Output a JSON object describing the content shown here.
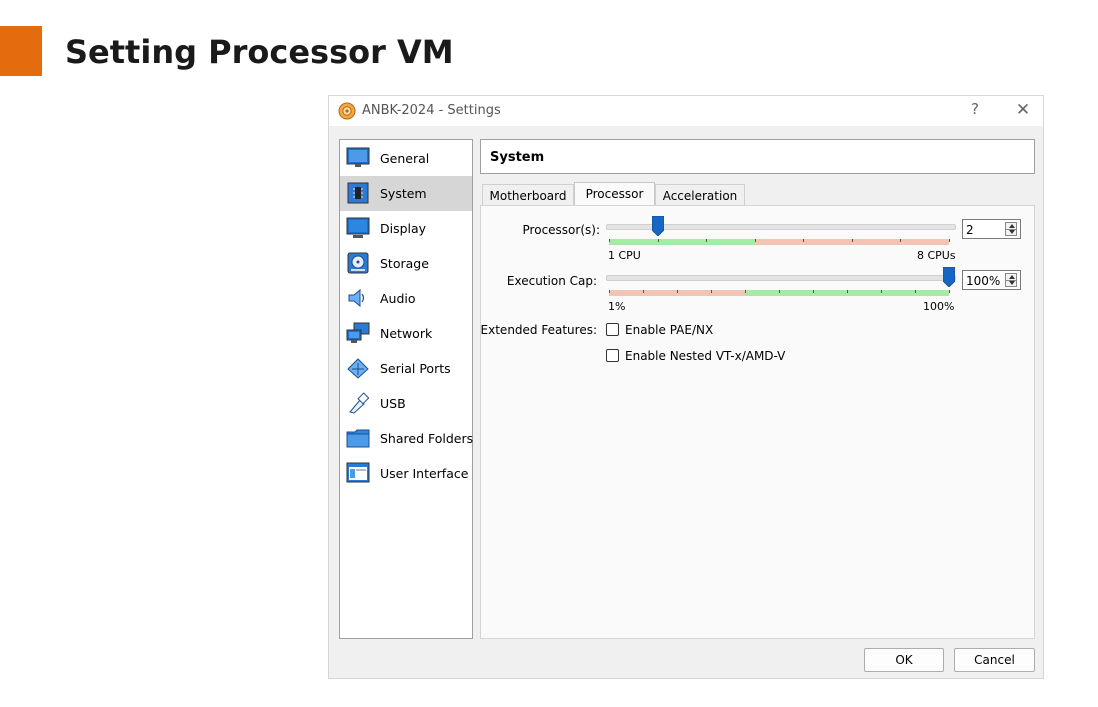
{
  "slide": {
    "title": "Setting Processor VM",
    "accent_color": "#e26c0e"
  },
  "window": {
    "title": "ANBK-2024 - Settings",
    "help_glyph": "?",
    "close_glyph": "✕",
    "app_icon": "virtualbox-gear-icon"
  },
  "sidebar": {
    "items": [
      {
        "label": "General",
        "icon": "general-monitor-icon"
      },
      {
        "label": "System",
        "icon": "system-chip-icon",
        "selected": true
      },
      {
        "label": "Display",
        "icon": "display-monitor-icon"
      },
      {
        "label": "Storage",
        "icon": "storage-disk-icon"
      },
      {
        "label": "Audio",
        "icon": "audio-speaker-icon"
      },
      {
        "label": "Network",
        "icon": "network-icon"
      },
      {
        "label": "Serial Ports",
        "icon": "serial-ports-icon"
      },
      {
        "label": "USB",
        "icon": "usb-icon"
      },
      {
        "label": "Shared Folders",
        "icon": "shared-folder-icon"
      },
      {
        "label": "User Interface",
        "icon": "user-interface-icon"
      }
    ]
  },
  "section": {
    "title": "System"
  },
  "tabs": [
    {
      "label": "Motherboard"
    },
    {
      "label": "Processor",
      "active": true
    },
    {
      "label": "Acceleration"
    }
  ],
  "processor": {
    "processors_label": "Processor(s):",
    "processors_value": "2",
    "processors_min_label": "1 CPU",
    "processors_max_label": "8 CPUs",
    "processors_fraction": 0.143,
    "exec_cap_label": "Execution Cap:",
    "exec_cap_value": "100%",
    "exec_cap_min_label": "1%",
    "exec_cap_max_label": "100%",
    "exec_cap_fraction": 1.0,
    "extended_label": "Extended Features:",
    "pae_label": "Enable PAE/NX",
    "pae_checked": false,
    "nested_label": "Enable Nested VT-x/AMD-V",
    "nested_checked": false
  },
  "buttons": {
    "ok": "OK",
    "cancel": "Cancel"
  },
  "colors": {
    "slider_thumb": "#1766c4",
    "zone_green": "#a5eba5",
    "zone_red": "#f3c4b4"
  }
}
